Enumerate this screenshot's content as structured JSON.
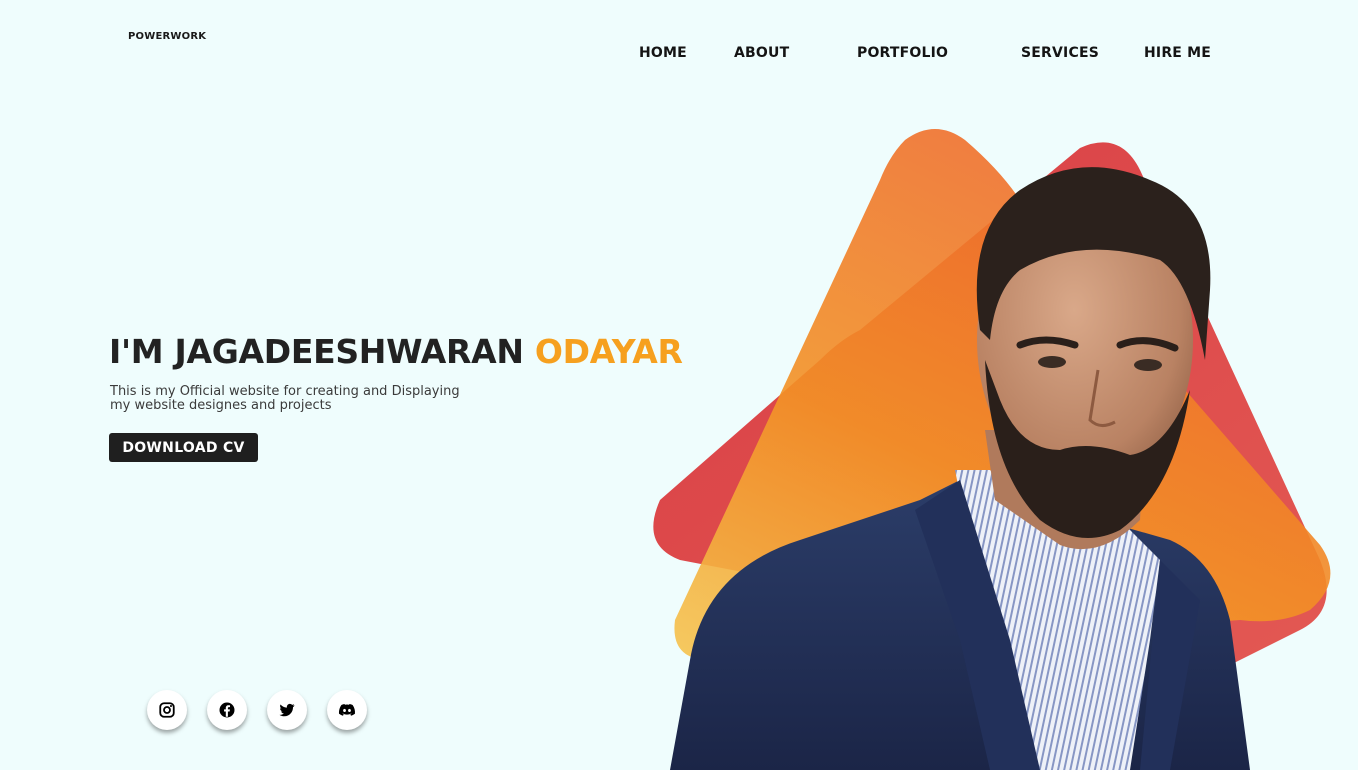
{
  "header": {
    "logo": "POWERWORK",
    "nav": [
      {
        "label": "HOME"
      },
      {
        "label": "ABOUT"
      },
      {
        "label": "PORTFOLIO"
      },
      {
        "label": "SERVICES"
      },
      {
        "label": "HIRE ME"
      }
    ]
  },
  "hero": {
    "title_main": "I'M JAGADEESHWARAN ",
    "title_accent": "ODAYAR",
    "subtitle_line1": "This is my Official website for creating and Displaying",
    "subtitle_line2": "my website designes and projects",
    "cta_label": "DOWNLOAD CV"
  },
  "social": [
    {
      "icon": "instagram-icon"
    },
    {
      "icon": "facebook-icon"
    },
    {
      "icon": "twitter-icon"
    },
    {
      "icon": "discord-icon"
    }
  ],
  "colors": {
    "background": "#effdfd",
    "accent": "#f6a01f",
    "button": "#1f1f1f",
    "shape_red": "#d93a3e",
    "shape_orange": "#f0752a",
    "shape_yellow": "#f6c44f"
  }
}
